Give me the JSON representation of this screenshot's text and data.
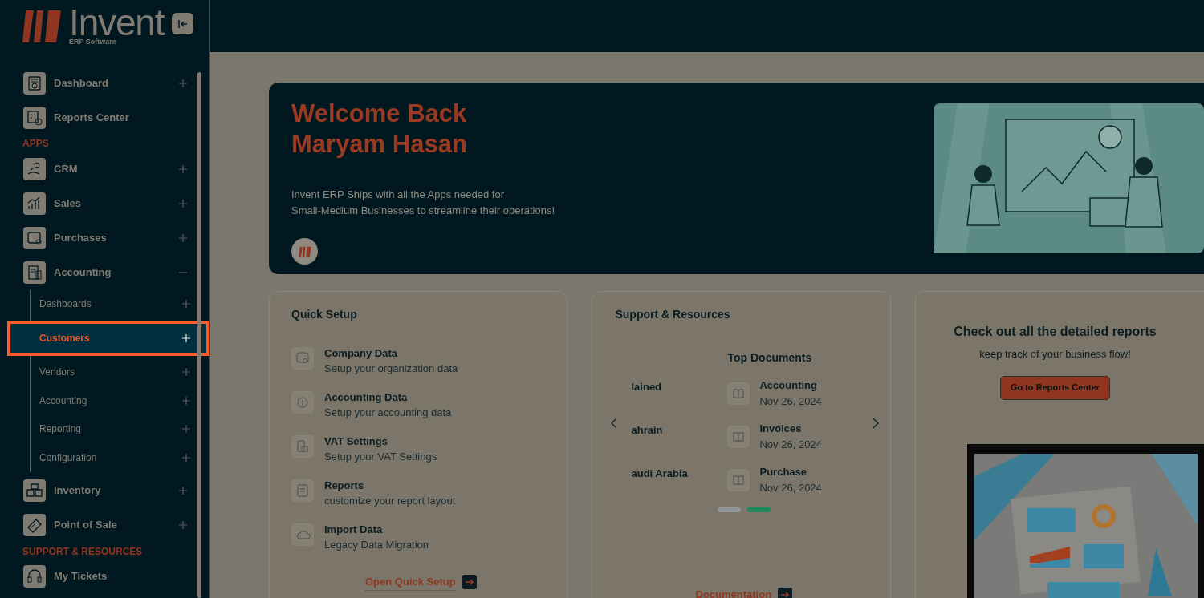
{
  "brand": {
    "name": "Invent",
    "tagline": "ERP Software"
  },
  "sidebar": {
    "items": [
      {
        "kind": "item",
        "label": "Dashboard",
        "expanded": false
      },
      {
        "kind": "item",
        "label": "Reports Center"
      },
      {
        "kind": "heading",
        "label": "APPS"
      },
      {
        "kind": "item",
        "label": "CRM",
        "expanded": false
      },
      {
        "kind": "item",
        "label": "Sales",
        "expanded": false
      },
      {
        "kind": "item",
        "label": "Purchases",
        "expanded": false
      },
      {
        "kind": "item",
        "label": "Accounting",
        "expanded": true,
        "children": [
          {
            "label": "Dashboards",
            "selected": false
          },
          {
            "label": "Customers",
            "selected": true
          },
          {
            "label": "Vendors",
            "selected": false
          },
          {
            "label": "Accounting",
            "selected": false
          },
          {
            "label": "Reporting",
            "selected": false
          },
          {
            "label": "Configuration",
            "selected": false
          }
        ]
      },
      {
        "kind": "item",
        "label": "Inventory",
        "expanded": false
      },
      {
        "kind": "item",
        "label": "Point of Sale",
        "expanded": false
      },
      {
        "kind": "heading",
        "label": "SUPPORT & RESOURCES"
      },
      {
        "kind": "item",
        "label": "My Tickets"
      }
    ]
  },
  "hero": {
    "title_lines": [
      "Welcome Back",
      "Maryam Hasan"
    ],
    "text_lines": [
      "Invent ERP Ships with all the Apps needed for",
      "Small-Medium Businesses to streamline their operations!"
    ]
  },
  "quick_setup": {
    "title": "Quick Setup",
    "items": [
      {
        "title": "Company Data",
        "subtitle": "Setup your organization data"
      },
      {
        "title": "Accounting Data",
        "subtitle": "Setup your accounting data"
      },
      {
        "title": "VAT Settings",
        "subtitle": "Setup your VAT Settings"
      },
      {
        "title": "Reports",
        "subtitle": "customize your report layout"
      },
      {
        "title": "Import Data",
        "subtitle": "Legacy Data Migration"
      }
    ],
    "link": "Open Quick Setup"
  },
  "support": {
    "title": "Support & Resources",
    "left_items": [
      "lained",
      "ahrain",
      "audi Arabia"
    ],
    "documents_title": "Top Documents",
    "documents": [
      {
        "title": "Accounting",
        "date": "Nov 26, 2024"
      },
      {
        "title": "Invoices",
        "date": "Nov 26, 2024"
      },
      {
        "title": "Purchase",
        "date": "Nov 26, 2024"
      }
    ],
    "pages": [
      {
        "selected": false
      },
      {
        "selected": true
      }
    ],
    "link": "Documentation"
  },
  "reports": {
    "title": "Check out all the detailed reports",
    "subtitle": "keep track of your business flow!",
    "button": "Go to Reports Center"
  }
}
